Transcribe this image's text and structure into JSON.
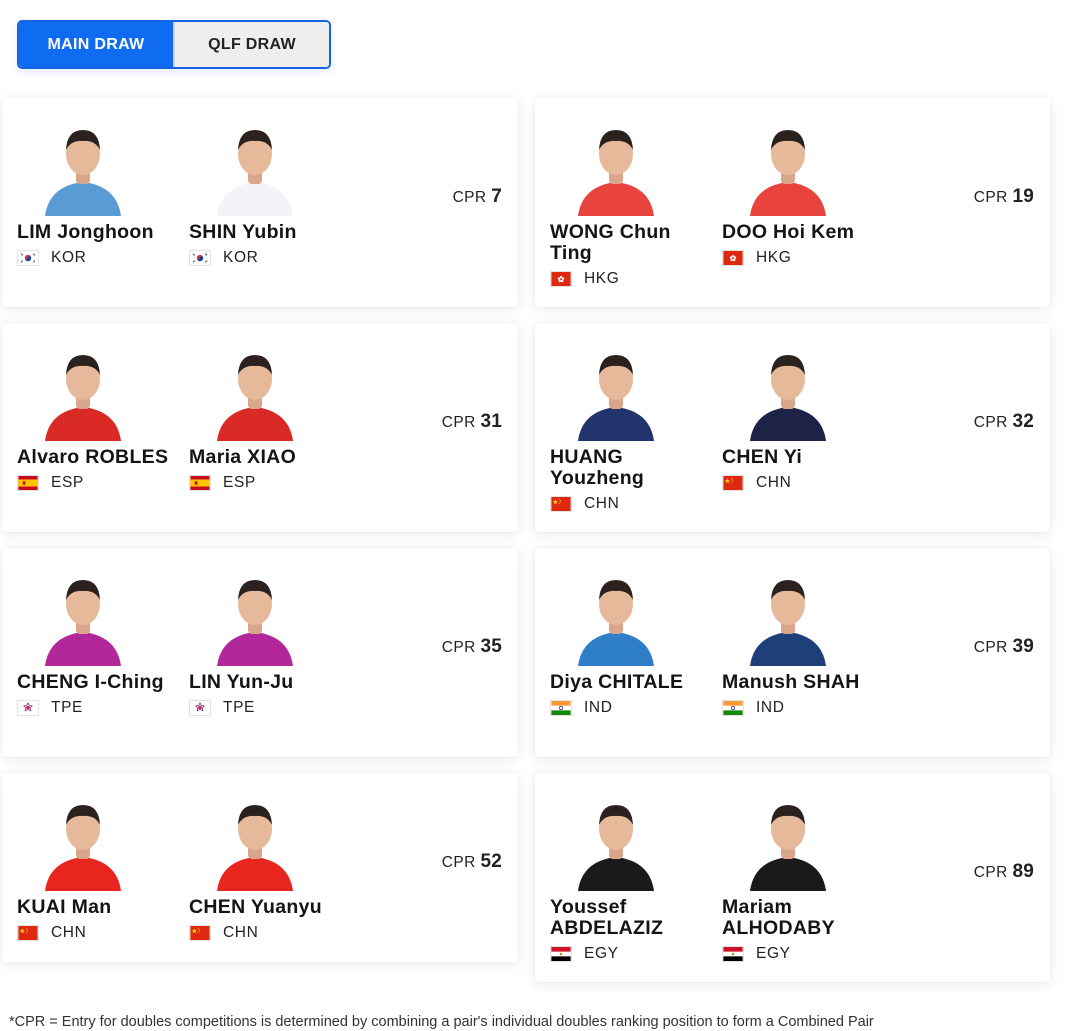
{
  "tabs": [
    {
      "label": "MAIN DRAW",
      "active": true
    },
    {
      "label": "QLF DRAW",
      "active": false
    }
  ],
  "cpr_label": "CPR",
  "pairs": [
    {
      "cpr": "7",
      "players": [
        {
          "name": "LIM Jonghoon",
          "country": "KOR",
          "flag": "flag-kor",
          "shirt": "#5b9bd5"
        },
        {
          "name": "SHIN Yubin",
          "country": "KOR",
          "flag": "flag-kor",
          "shirt": "#f4f4f8"
        }
      ]
    },
    {
      "cpr": "19",
      "players": [
        {
          "name": "WONG Chun Ting",
          "country": "HKG",
          "flag": "flag-hkg",
          "shirt": "#e8433d"
        },
        {
          "name": "DOO Hoi Kem",
          "country": "HKG",
          "flag": "flag-hkg",
          "shirt": "#e8433d"
        }
      ]
    },
    {
      "cpr": "31",
      "players": [
        {
          "name": "Alvaro ROBLES",
          "country": "ESP",
          "flag": "flag-esp",
          "shirt": "#d92a25"
        },
        {
          "name": "Maria XIAO",
          "country": "ESP",
          "flag": "flag-esp",
          "shirt": "#d92a25"
        }
      ]
    },
    {
      "cpr": "32",
      "players": [
        {
          "name": "HUANG Youzheng",
          "country": "CHN",
          "flag": "flag-chn",
          "shirt": "#23336b"
        },
        {
          "name": "CHEN Yi",
          "country": "CHN",
          "flag": "flag-chn",
          "shirt": "#1d2346"
        }
      ]
    },
    {
      "cpr": "35",
      "players": [
        {
          "name": "CHENG I-Ching",
          "country": "TPE",
          "flag": "flag-tpe",
          "shirt": "#b2279a"
        },
        {
          "name": "LIN Yun-Ju",
          "country": "TPE",
          "flag": "flag-tpe",
          "shirt": "#b2279a"
        }
      ]
    },
    {
      "cpr": "39",
      "players": [
        {
          "name": "Diya CHITALE",
          "country": "IND",
          "flag": "flag-ind",
          "shirt": "#2f7fc8"
        },
        {
          "name": "Manush SHAH",
          "country": "IND",
          "flag": "flag-ind",
          "shirt": "#1f3f7a"
        }
      ]
    },
    {
      "cpr": "52",
      "players": [
        {
          "name": "KUAI Man",
          "country": "CHN",
          "flag": "flag-chn",
          "shirt": "#e8261f"
        },
        {
          "name": "CHEN Yuanyu",
          "country": "CHN",
          "flag": "flag-chn",
          "shirt": "#e8261f"
        }
      ]
    },
    {
      "cpr": "89",
      "players": [
        {
          "name": "Youssef ABDELAZIZ",
          "country": "EGY",
          "flag": "flag-egy",
          "shirt": "#1a1a1a"
        },
        {
          "name": "Mariam ALHODABY",
          "country": "EGY",
          "flag": "flag-egy",
          "shirt": "#1a1a1a"
        }
      ]
    }
  ],
  "footnote": "*CPR = Entry for doubles competitions is determined by combining a pair's individual doubles ranking position to form a Combined Pair"
}
